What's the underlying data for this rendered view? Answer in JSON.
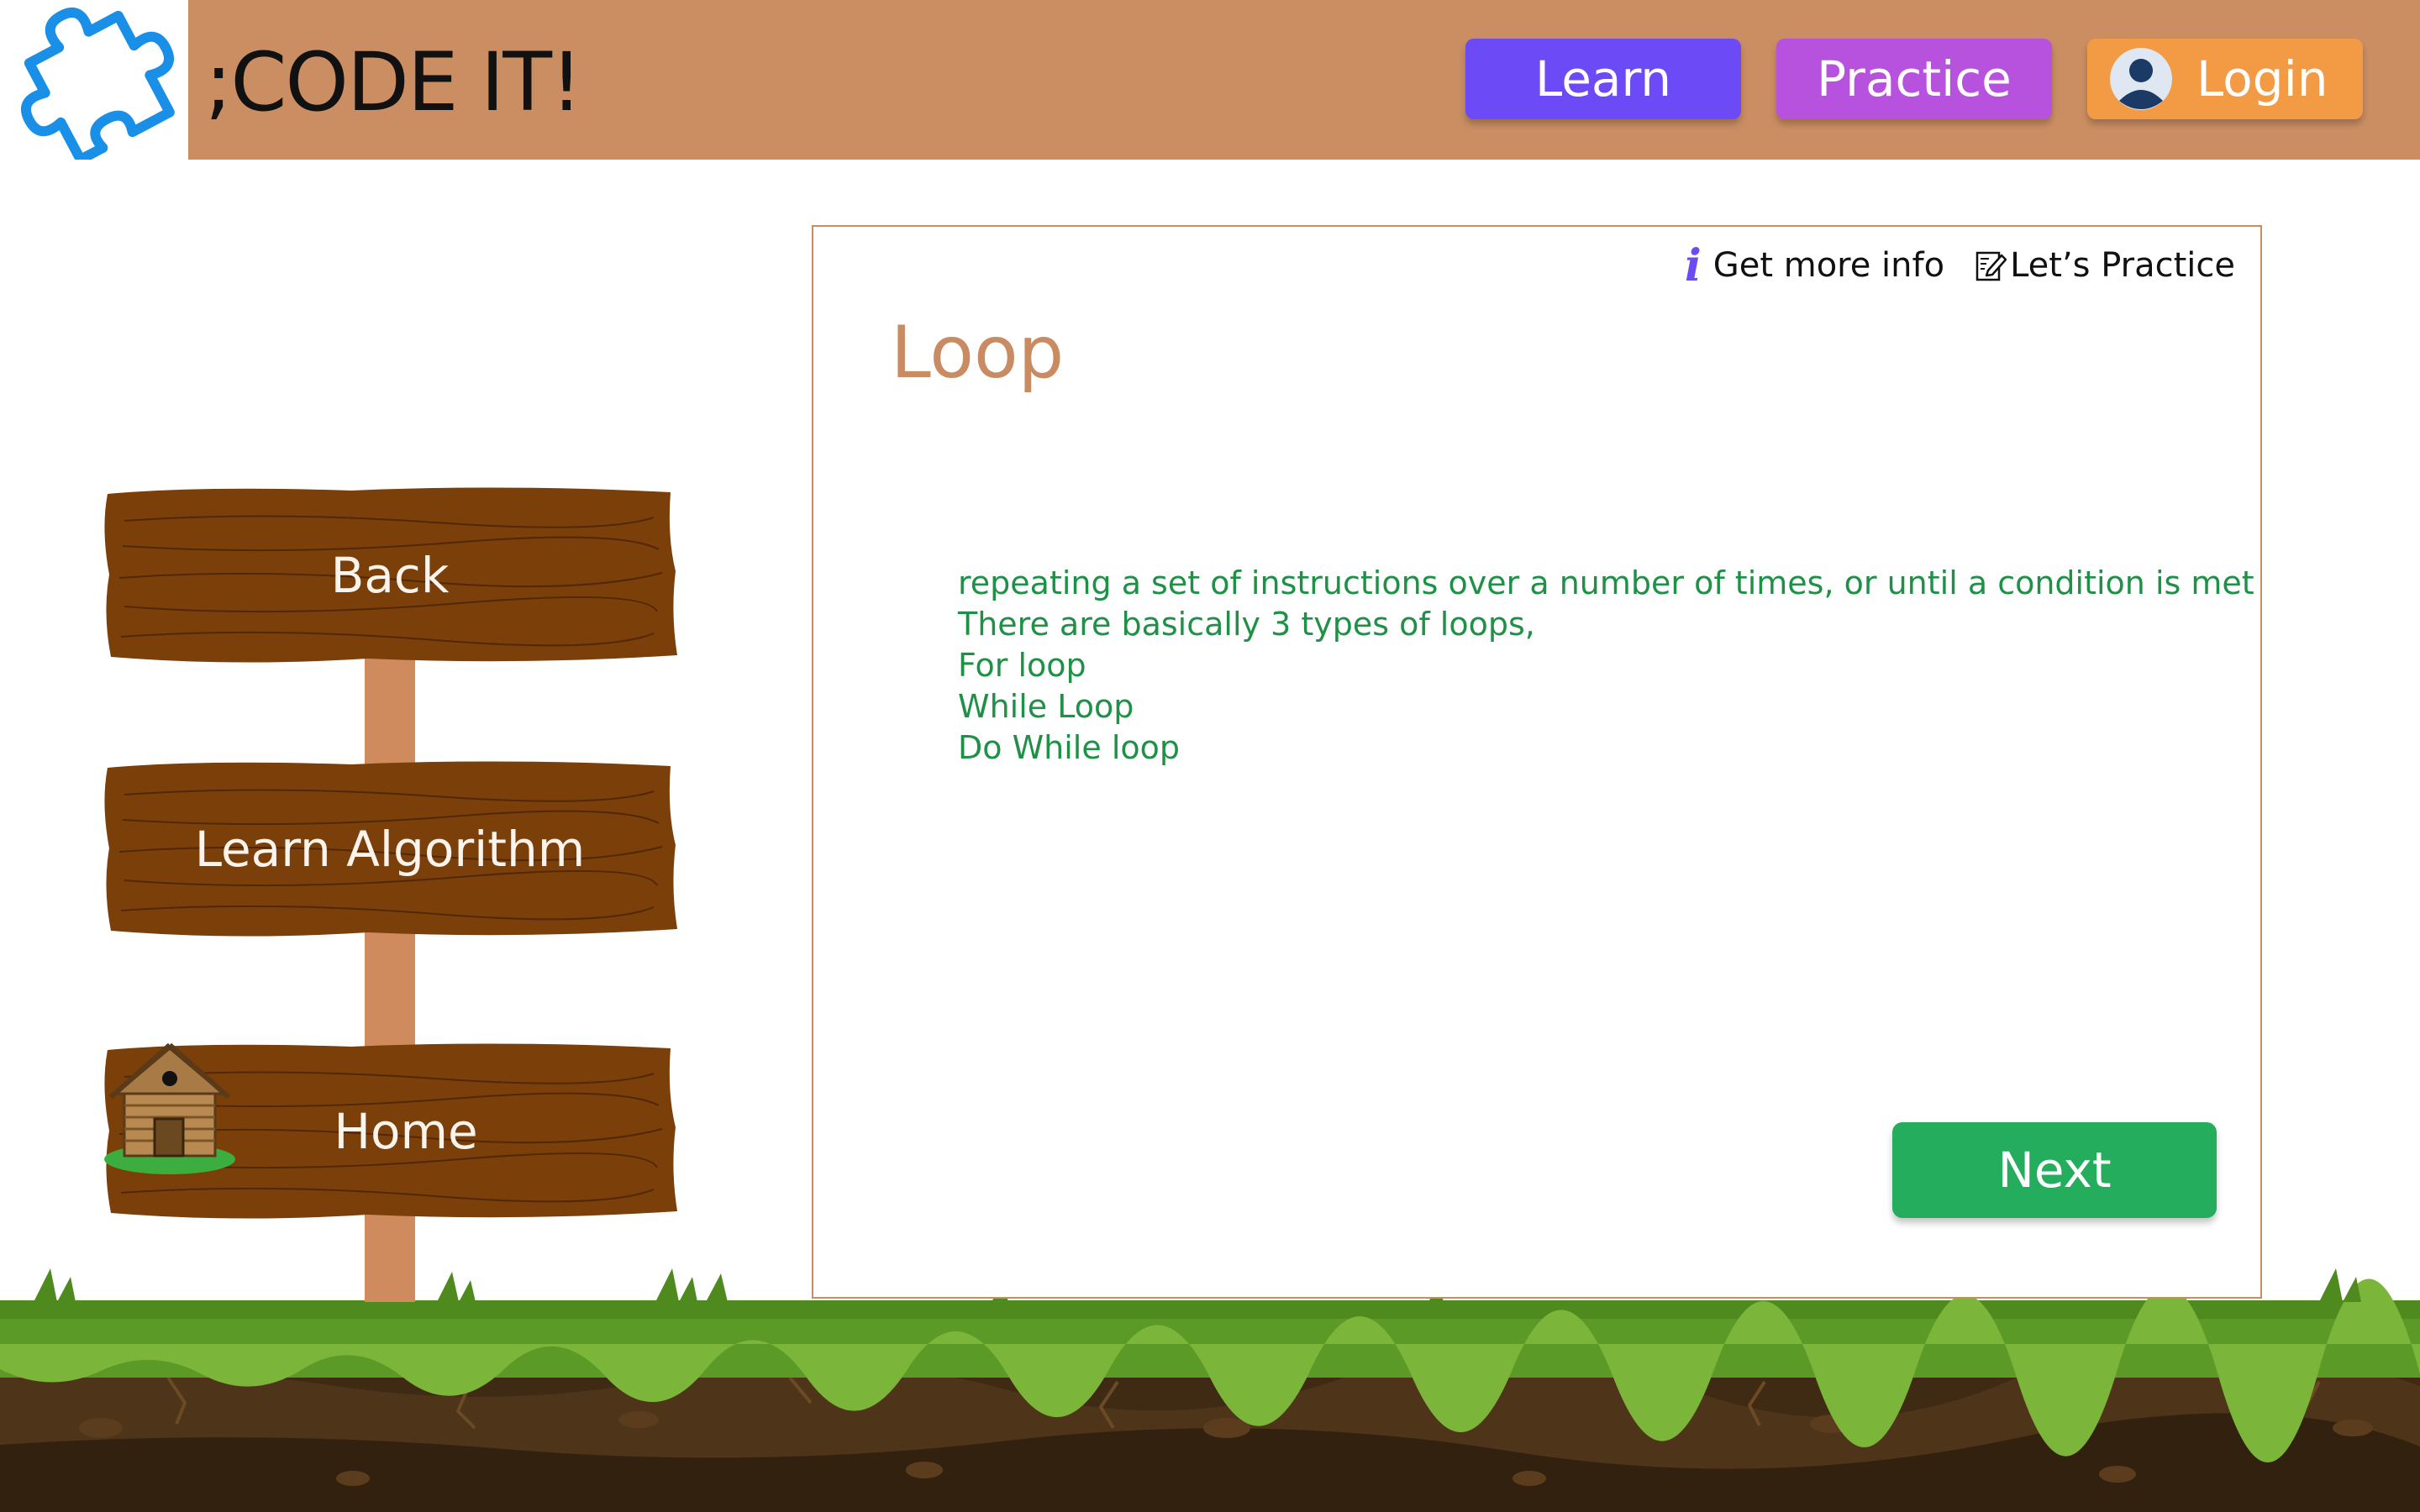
{
  "header": {
    "brand": ";CODE IT!",
    "nav": {
      "learn": "Learn",
      "practice": "Practice",
      "login": "Login"
    }
  },
  "signpost": {
    "back": "Back",
    "learn_algorithm": "Learn Algorithm",
    "home": "Home"
  },
  "card": {
    "tools": {
      "info_icon": "i",
      "get_more_info": "Get more info",
      "lets_practice": "Let’s Practice"
    },
    "title": "Loop",
    "body": [
      "repeating a set of instructions over a number of times, or until a condition is met",
      "There are basically 3 types of loops,",
      "For loop",
      "While Loop",
      "Do While loop"
    ],
    "next": "Next"
  },
  "icons": {
    "logo": "puzzle-piece-icon",
    "login": "user-avatar-icon",
    "home": "cabin-icon",
    "practice": "pencil-edit-icon",
    "info": "info-icon"
  },
  "colors": {
    "header_bg": "#cb8e63",
    "learn_btn": "#6c4bf7",
    "practice_btn": "#b752df",
    "login_btn": "#f39a45",
    "next_btn": "#23ad5d",
    "title": "#c98b61",
    "body_text": "#1f9147",
    "wood": "#7b3f0a",
    "grass": "#5c9a27"
  }
}
